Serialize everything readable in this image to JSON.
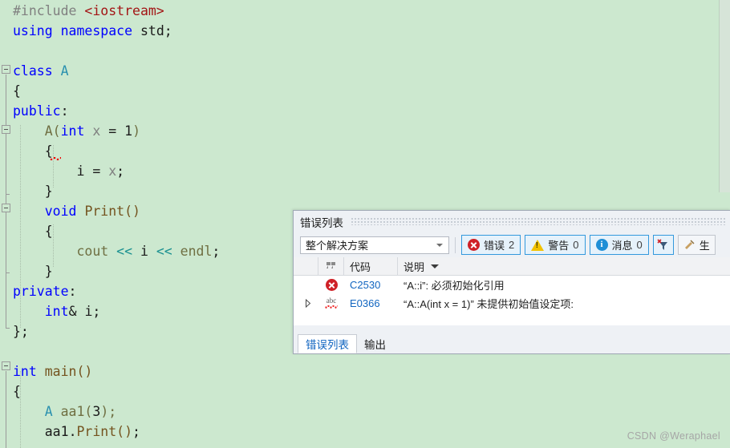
{
  "editor": {
    "background_color": "#cce8cf",
    "lines": [
      {
        "indent": 0,
        "tokens": [
          {
            "t": "#include ",
            "c": "t-pre"
          },
          {
            "t": "<iostream>",
            "c": "t-str"
          }
        ]
      },
      {
        "indent": 0,
        "tokens": [
          {
            "t": "using",
            "c": "t-kw"
          },
          {
            "t": " ",
            "c": "t-plain"
          },
          {
            "t": "namespace",
            "c": "t-kw"
          },
          {
            "t": " ",
            "c": "t-plain"
          },
          {
            "t": "std",
            "c": "t-plain"
          },
          {
            "t": ";",
            "c": "t-plain"
          }
        ]
      },
      {
        "indent": 0,
        "tokens": []
      },
      {
        "indent": 0,
        "tokens": [
          {
            "t": "class",
            "c": "t-kw"
          },
          {
            "t": " ",
            "c": "t-plain"
          },
          {
            "t": "A",
            "c": "t-type"
          }
        ]
      },
      {
        "indent": 0,
        "tokens": [
          {
            "t": "{",
            "c": "t-plain"
          }
        ]
      },
      {
        "indent": 0,
        "tokens": [
          {
            "t": "public",
            "c": "t-kw"
          },
          {
            "t": ":",
            "c": "t-plain"
          }
        ]
      },
      {
        "indent": 1,
        "tokens": [
          {
            "t": "A(",
            "c": "t-ident"
          },
          {
            "t": "int",
            "c": "t-kw"
          },
          {
            "t": " ",
            "c": "t-plain"
          },
          {
            "t": "x",
            "c": "t-var"
          },
          {
            "t": " = ",
            "c": "t-plain"
          },
          {
            "t": "1",
            "c": "t-num"
          },
          {
            "t": ")",
            "c": "t-ident"
          }
        ]
      },
      {
        "indent": 1,
        "tokens": [
          {
            "t": "{",
            "c": "t-plain"
          }
        ]
      },
      {
        "indent": 2,
        "tokens": [
          {
            "t": "i",
            "c": "t-plain"
          },
          {
            "t": " = ",
            "c": "t-plain"
          },
          {
            "t": "x",
            "c": "t-var"
          },
          {
            "t": ";",
            "c": "t-plain"
          }
        ]
      },
      {
        "indent": 1,
        "tokens": [
          {
            "t": "}",
            "c": "t-plain"
          }
        ]
      },
      {
        "indent": 1,
        "tokens": [
          {
            "t": "void",
            "c": "t-kw"
          },
          {
            "t": " ",
            "c": "t-plain"
          },
          {
            "t": "Print()",
            "c": "t-fn"
          }
        ]
      },
      {
        "indent": 1,
        "tokens": [
          {
            "t": "{",
            "c": "t-plain"
          }
        ]
      },
      {
        "indent": 2,
        "tokens": [
          {
            "t": "cout",
            "c": "t-ident"
          },
          {
            "t": " ",
            "c": "t-plain"
          },
          {
            "t": "<<",
            "c": "t-op"
          },
          {
            "t": " ",
            "c": "t-plain"
          },
          {
            "t": "i",
            "c": "t-plain"
          },
          {
            "t": " ",
            "c": "t-plain"
          },
          {
            "t": "<<",
            "c": "t-op"
          },
          {
            "t": " ",
            "c": "t-plain"
          },
          {
            "t": "endl",
            "c": "t-ident"
          },
          {
            "t": ";",
            "c": "t-plain"
          }
        ]
      },
      {
        "indent": 1,
        "tokens": [
          {
            "t": "}",
            "c": "t-plain"
          }
        ]
      },
      {
        "indent": 0,
        "tokens": [
          {
            "t": "private",
            "c": "t-kw"
          },
          {
            "t": ":",
            "c": "t-plain"
          }
        ]
      },
      {
        "indent": 1,
        "tokens": [
          {
            "t": "int",
            "c": "t-kw"
          },
          {
            "t": "& ",
            "c": "t-plain"
          },
          {
            "t": "i",
            "c": "t-plain"
          },
          {
            "t": ";",
            "c": "t-plain"
          }
        ]
      },
      {
        "indent": 0,
        "tokens": [
          {
            "t": "};",
            "c": "t-plain"
          }
        ]
      },
      {
        "indent": 0,
        "tokens": []
      },
      {
        "indent": 0,
        "tokens": [
          {
            "t": "int",
            "c": "t-kw"
          },
          {
            "t": " ",
            "c": "t-plain"
          },
          {
            "t": "main()",
            "c": "t-fn"
          }
        ]
      },
      {
        "indent": 0,
        "tokens": [
          {
            "t": "{",
            "c": "t-plain"
          }
        ]
      },
      {
        "indent": 1,
        "tokens": [
          {
            "t": "A",
            "c": "t-type"
          },
          {
            "t": " ",
            "c": "t-plain"
          },
          {
            "t": "aa1(",
            "c": "t-ident"
          },
          {
            "t": "3",
            "c": "t-num"
          },
          {
            "t": ");",
            "c": "t-ident"
          }
        ]
      },
      {
        "indent": 1,
        "tokens": [
          {
            "t": "aa1",
            "c": "t-plain"
          },
          {
            "t": ".",
            "c": "t-plain"
          },
          {
            "t": "Print()",
            "c": "t-fn"
          },
          {
            "t": ";",
            "c": "t-plain"
          }
        ]
      }
    ]
  },
  "error_list": {
    "title": "错误列表",
    "scope_filter": {
      "value": "整个解决方案"
    },
    "toggles": [
      {
        "name": "errors",
        "label": "错误",
        "count": "2",
        "icon": "error-icon"
      },
      {
        "name": "warnings",
        "label": "警告",
        "count": "0",
        "icon": "warning-icon"
      },
      {
        "name": "messages",
        "label": "消息",
        "count": "0",
        "icon": "info-icon"
      }
    ],
    "filter_button_tooltip": "清除筛选器",
    "build_button_label": "生",
    "columns": {
      "icon": "",
      "code": "代码",
      "description": "说明"
    },
    "rows": [
      {
        "severity": "error",
        "icon": "error-icon",
        "expandable": false,
        "code": "C2530",
        "description": "“A::i”: 必须初始化引用"
      },
      {
        "severity": "intellisense",
        "icon": "intellisense-abc-icon",
        "expandable": true,
        "code": "E0366",
        "description": "“A::A(int x = 1)” 未提供初始值设定项:"
      }
    ],
    "tabs": [
      {
        "label": "错误列表",
        "active": true
      },
      {
        "label": "输出",
        "active": false
      }
    ]
  },
  "watermark": {
    "text": "CSDN @Weraphael"
  }
}
